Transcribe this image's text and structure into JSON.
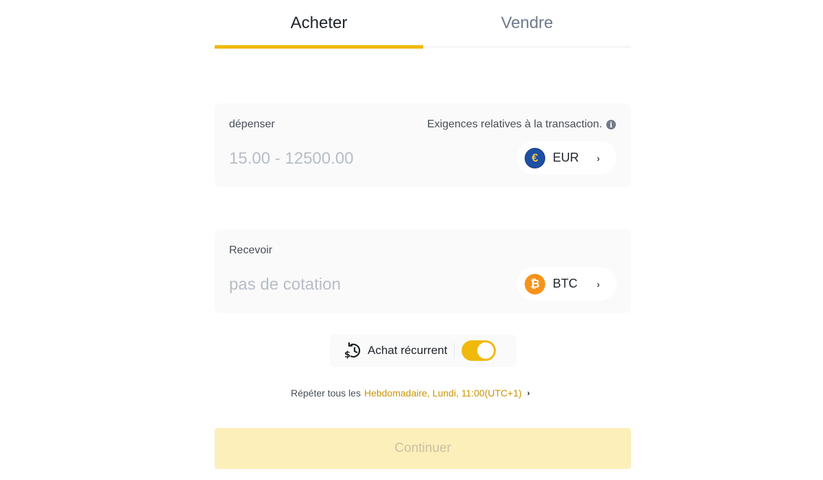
{
  "tabs": {
    "buy_label": "Acheter",
    "sell_label": "Vendre",
    "active": "Acheter"
  },
  "spend": {
    "label": "dépenser",
    "requirements_text": "Exigences relatives à la transaction.",
    "placeholder": "15.00 - 12500.00",
    "currency_code": "EUR",
    "currency_symbol": "€"
  },
  "receive": {
    "label": "Recevoir",
    "placeholder": "pas de cotation",
    "currency_code": "BTC",
    "currency_symbol": "₿"
  },
  "recurring": {
    "label": "Achat récurrent",
    "enabled": true
  },
  "repeat": {
    "prefix": "Répéter tous les",
    "schedule": "Hebdomadaire, Lundi, 11:00(UTC+1)"
  },
  "continue_label": "Continuer",
  "colors": {
    "accent": "#f0b90b",
    "link": "#c99400",
    "button_disabled_bg": "#fcefba"
  }
}
